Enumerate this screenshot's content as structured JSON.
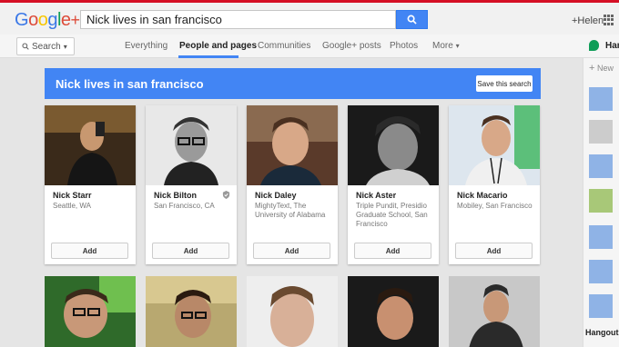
{
  "app": {
    "logo": "Google+",
    "user": "+Helen"
  },
  "search": {
    "query": "Nick lives in san francisco",
    "dropdown_label": "Search"
  },
  "nav": {
    "tabs": [
      {
        "label": "Everything",
        "active": false
      },
      {
        "label": "People and pages",
        "active": true
      },
      {
        "label": "Communities",
        "active": false
      },
      {
        "label": "Google+ posts",
        "active": false
      },
      {
        "label": "Photos",
        "active": false
      },
      {
        "label": "More",
        "active": false
      }
    ],
    "hangouts": "Hango"
  },
  "banner": {
    "title": "Nick lives in san francisco",
    "save_label": "Save this search"
  },
  "results": [
    {
      "name": "Nick Starr",
      "location": "Seattle, WA",
      "add": "Add",
      "verified": false
    },
    {
      "name": "Nick Bilton",
      "location": "San Francisco, CA",
      "add": "Add",
      "verified": true
    },
    {
      "name": "Nick Daley",
      "location": "MightyText, The University of Alabama",
      "add": "Add",
      "verified": false
    },
    {
      "name": "Nick Aster",
      "location": "Triple Pundit, Presidio Graduate School, San Francisco",
      "add": "Add",
      "verified": false
    },
    {
      "name": "Nick Macario",
      "location": "Mobiley, San Francisco",
      "add": "Add",
      "verified": false
    }
  ],
  "sidebar": {
    "new_label": "New",
    "hangouts_label": "Hangout"
  },
  "colors": {
    "accent": "#4285f4",
    "topline": "#d50f25"
  }
}
